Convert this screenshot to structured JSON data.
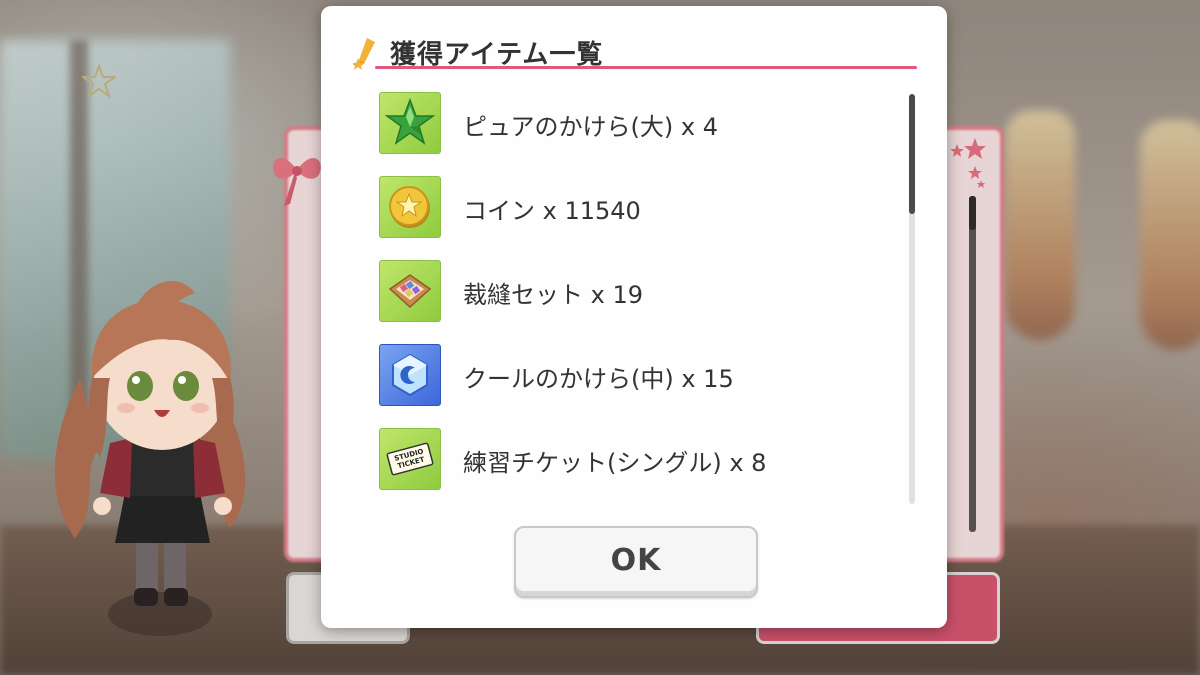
{
  "dialog": {
    "title": "獲得アイテム一覧",
    "ok_label": "OK"
  },
  "items": [
    {
      "label": "ピュアのかけら(大) x 4",
      "icon": "green-star-shard-icon"
    },
    {
      "label": "コイン x 11540",
      "icon": "coin-icon"
    },
    {
      "label": "裁縫セット x 19",
      "icon": "sewing-kit-icon"
    },
    {
      "label": "クールのかけら(中) x 15",
      "icon": "blue-crystal-shard-icon"
    },
    {
      "label": "練習チケット(シングル) x 8",
      "icon": "studio-ticket-icon"
    }
  ],
  "ticket_icon_text": [
    "STUDIO",
    "TICKET"
  ],
  "colors": {
    "accent": "#e0587a",
    "modal_bg": "#fefefe",
    "item_icon_bg": "#a7d64a"
  }
}
